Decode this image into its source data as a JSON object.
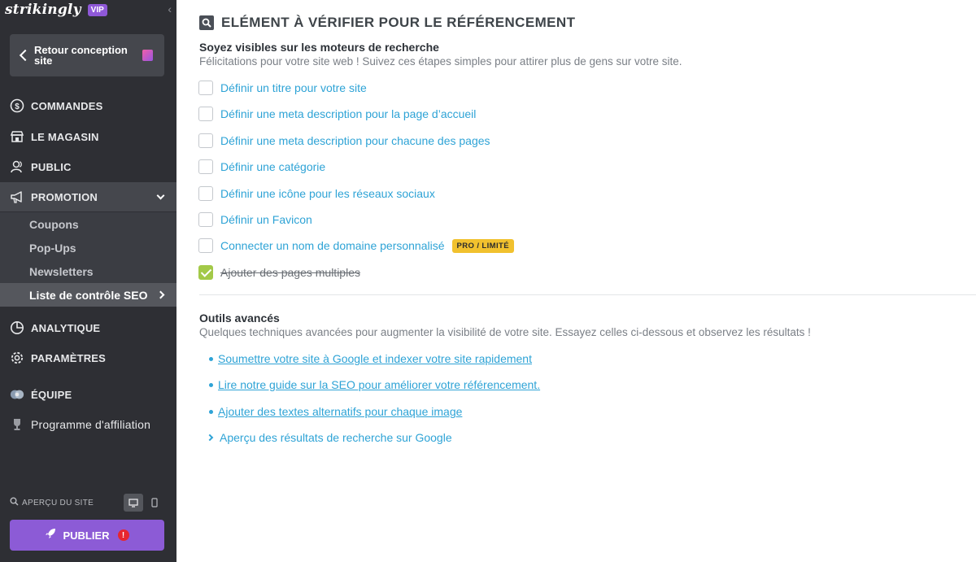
{
  "sidebar": {
    "brand": "strikingly",
    "vip_badge": "VIP",
    "back_button": "Retour conception site",
    "nav": [
      {
        "label": "Commandes",
        "icon": "dollar-circle-icon"
      },
      {
        "label": "Le magasin",
        "icon": "store-icon"
      },
      {
        "label": "Public",
        "icon": "users-icon"
      },
      {
        "label": "Promotion",
        "icon": "megaphone-icon"
      },
      {
        "label": "Analytique",
        "icon": "pie-chart-icon"
      },
      {
        "label": "Paramètres",
        "icon": "gear-icon"
      },
      {
        "label": "Équipe",
        "icon": "team-icon"
      },
      {
        "label": "Programme d'affiliation",
        "icon": "trophy-icon"
      }
    ],
    "promotion_sub": [
      {
        "label": "Coupons"
      },
      {
        "label": "Pop-Ups"
      },
      {
        "label": "Newsletters"
      },
      {
        "label": "Liste de contrôle SEO"
      }
    ],
    "preview_label": "APERÇU DU SITE",
    "publish_label": "PUBLIER",
    "publish_alert": "!"
  },
  "main": {
    "title": "Elément à vérifier pour le référencement",
    "section1": {
      "heading": "Soyez visibles sur les moteurs de recherche",
      "subtitle": "Félicitations pour votre site web ! Suivez ces étapes simples pour attirer plus de gens sur votre site.",
      "items": [
        {
          "label": "Définir un titre pour votre site",
          "checked": false
        },
        {
          "label": "Définir une meta description pour la page d’accueil",
          "checked": false
        },
        {
          "label": "Définir une meta description pour chacune des pages",
          "checked": false
        },
        {
          "label": "Définir une catégorie",
          "checked": false
        },
        {
          "label": "Définir une icône pour les réseaux sociaux",
          "checked": false
        },
        {
          "label": "Définir un Favicon",
          "checked": false
        },
        {
          "label": "Connecter un nom de domaine personnalisé",
          "checked": false,
          "badge": "PRO / LIMITÉ"
        },
        {
          "label": "Ajouter des pages multiples",
          "checked": true
        }
      ]
    },
    "section2": {
      "heading": "Outils avancés",
      "subtitle": "Quelques techniques avancées pour augmenter la visibilité de votre site. Essayez celles ci-dessous et observez les résultats !",
      "links": [
        {
          "label": "Soumettre votre site à Google et indexer votre site rapidement"
        },
        {
          "label": "Lire notre guide sur la SEO pour améliorer votre référencement."
        },
        {
          "label": "Ajouter des textes alternatifs pour chaque image"
        }
      ],
      "expander": "Aperçu des résultats de recherche sur Google"
    }
  },
  "colors": {
    "sidebar_bg": "#2e2f34",
    "accent_purple": "#8c5bd6",
    "link_blue": "#2ea3d6",
    "check_green": "#a3c948",
    "badge_yellow": "#f1c12e"
  }
}
